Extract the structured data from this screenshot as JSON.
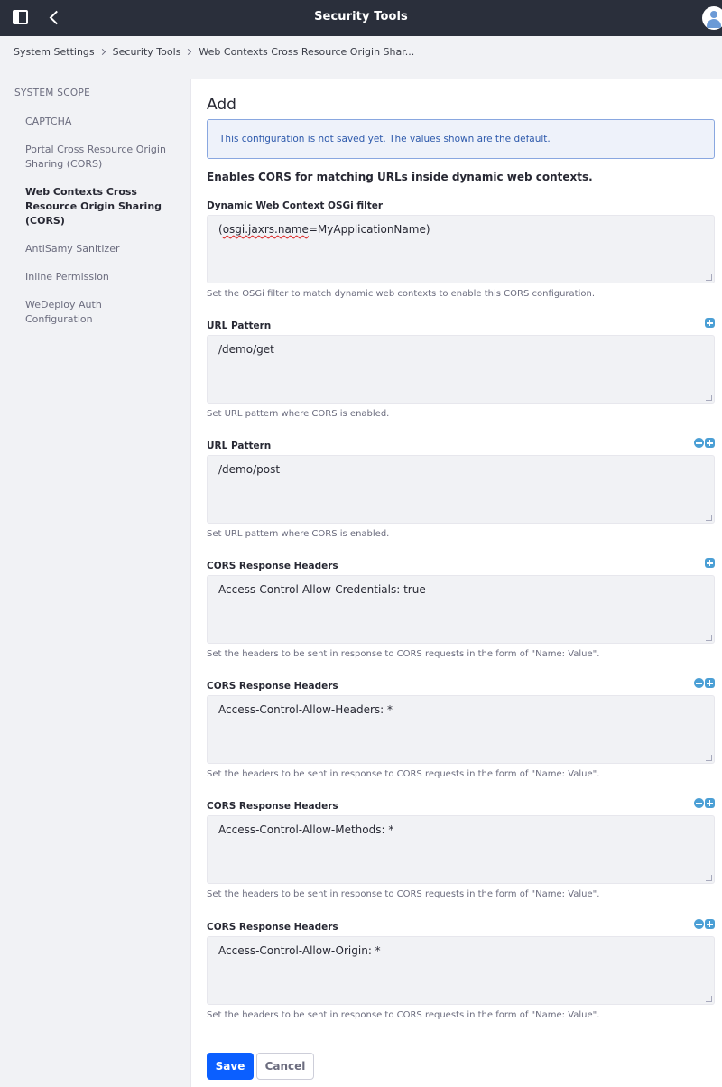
{
  "topbar": {
    "title": "Security Tools"
  },
  "breadcrumb": [
    "System Settings",
    "Security Tools",
    "Web Contexts Cross Resource Origin Shar..."
  ],
  "sidebar": {
    "scope_label": "SYSTEM SCOPE",
    "items": [
      {
        "label": "CAPTCHA",
        "active": false
      },
      {
        "label": "Portal Cross Resource Origin Sharing (CORS)",
        "active": false
      },
      {
        "label": "Web Contexts Cross Resource Origin Sharing (CORS)",
        "active": true
      },
      {
        "label": "AntiSamy Sanitizer",
        "active": false
      },
      {
        "label": "Inline Permission",
        "active": false
      },
      {
        "label": "WeDeploy Auth Configuration",
        "active": false
      }
    ]
  },
  "main": {
    "heading": "Add",
    "alert": "This configuration is not saved yet. The values shown are the default.",
    "description": "Enables CORS for matching URLs inside dynamic web contexts.",
    "fields": [
      {
        "label": "Dynamic Web Context OSGi filter",
        "value_prefix": "(",
        "value_underlined": "osgi.jaxrs.name",
        "value_suffix": "=MyApplicationName)",
        "help": "Set the OSGi filter to match dynamic web contexts to enable this CORS configuration."
      },
      {
        "label": "URL Pattern",
        "value": "/demo/get",
        "help": "Set URL pattern where CORS is enabled."
      },
      {
        "label": "URL Pattern",
        "value": "/demo/post",
        "help": "Set URL pattern where CORS is enabled."
      },
      {
        "label": "CORS Response Headers",
        "value": "Access-Control-Allow-Credentials: true",
        "help": "Set the headers to be sent in response to CORS requests in the form of \"Name: Value\"."
      },
      {
        "label": "CORS Response Headers",
        "value": "Access-Control-Allow-Headers: *",
        "help": "Set the headers to be sent in response to CORS requests in the form of \"Name: Value\"."
      },
      {
        "label": "CORS Response Headers",
        "value": "Access-Control-Allow-Methods: *",
        "help": "Set the headers to be sent in response to CORS requests in the form of \"Name: Value\"."
      },
      {
        "label": "CORS Response Headers",
        "value": "Access-Control-Allow-Origin: *",
        "help": "Set the headers to be sent in response to CORS requests in the form of \"Name: Value\"."
      }
    ],
    "save_label": "Save",
    "cancel_label": "Cancel"
  },
  "colors": {
    "topbar_bg": "#2a2f3b",
    "primary": "#0b5fff",
    "alert_text": "#2e5aac",
    "control_icon": "#4b9fd5"
  }
}
